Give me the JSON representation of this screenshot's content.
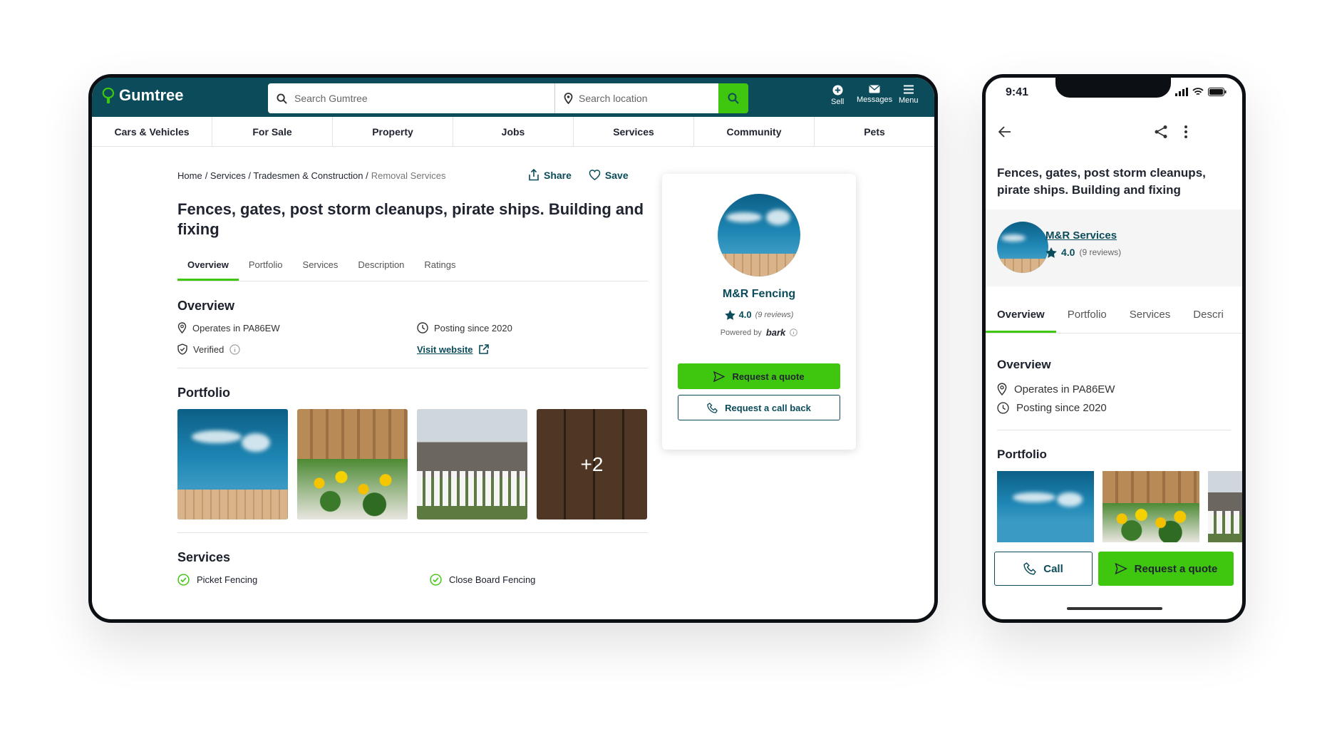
{
  "desktop": {
    "brand": "Gumtree",
    "search_placeholder": "Search Gumtree",
    "location_placeholder": "Search location",
    "topbar_items": [
      "Sell",
      "Messages",
      "Menu"
    ],
    "categories": [
      "Cars & Vehicles",
      "For Sale",
      "Property",
      "Jobs",
      "Services",
      "Community",
      "Pets"
    ],
    "breadcrumb": [
      "Home",
      "/ Services / Tradesmen & Construction /",
      "Removal Services"
    ],
    "share": "Share",
    "save": "Save",
    "title": "Fences, gates, post storm cleanups, pirate ships. Building and fixing",
    "tabs": [
      "Overview",
      "Portfolio",
      "Services",
      "Description",
      "Ratings"
    ],
    "overview_heading": "Overview",
    "operates": "Operates in PA86EW",
    "posting_since": "Posting since 2020",
    "verified": "Verified",
    "visit_website": "Visit website",
    "portfolio_heading": "Portfolio",
    "portfolio_more": "+2",
    "services_heading": "Services",
    "services": [
      "Picket Fencing",
      "Close Board Fencing"
    ],
    "card": {
      "business_name": "M&R Fencing",
      "rating": "4.0",
      "reviews": "(9 reviews)",
      "powered_by": "Powered by",
      "bark": "bark",
      "quote_button": "Request a quote",
      "callback_button": "Request a call back"
    }
  },
  "mobile": {
    "time": "9:41",
    "title": "Fences, gates, post storm cleanups, pirate ships. Building and fixing",
    "business_name": "M&R Services",
    "rating": "4.0",
    "reviews": "(9 reviews)",
    "tabs": [
      "Overview",
      "Portfolio",
      "Services",
      "Descri"
    ],
    "overview_heading": "Overview",
    "operates": "Operates in PA86EW",
    "posting_since": "Posting since 2020",
    "portfolio_heading": "Portfolio",
    "call_button": "Call",
    "quote_button": "Request a quote"
  },
  "colors": {
    "brand_teal": "#0b4b5a",
    "accent_green": "#3fc70f"
  }
}
